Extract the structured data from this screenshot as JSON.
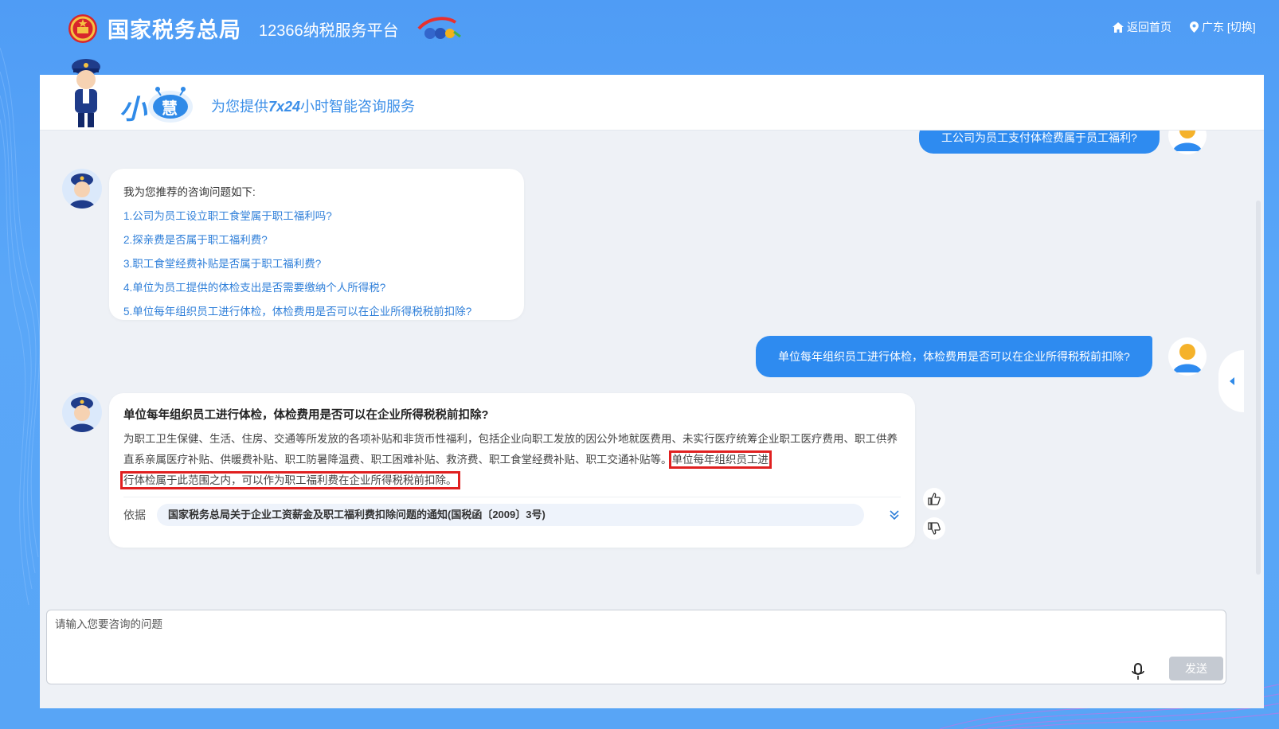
{
  "header": {
    "brand": "国家税务总局",
    "platform": "12366纳税服务平台",
    "home_link": "返回首页",
    "region": "广东 [切换]"
  },
  "assistant": {
    "name_part1": "小",
    "name_part2": "慧",
    "tagline_pre": "为您提供",
    "tagline_hl": "7x24",
    "tagline_post": "小时智能咨询服务"
  },
  "chat": {
    "user_msg_1": "工公司为员工支付体检费属于员工福利?",
    "recommend": {
      "intro": "我为您推荐的咨询问题如下:",
      "items": [
        "1.公司为员工设立职工食堂属于职工福利吗?",
        "2.探亲费是否属于职工福利费?",
        "3.职工食堂经费补贴是否属于职工福利费?",
        "4.单位为员工提供的体检支出是否需要缴纳个人所得税?",
        "5.单位每年组织员工进行体检，体检费用是否可以在企业所得税税前扣除?"
      ]
    },
    "user_msg_2": "单位每年组织员工进行体检，体检费用是否可以在企业所得税税前扣除?",
    "answer": {
      "title": "单位每年组织员工进行体检，体检费用是否可以在企业所得税税前扣除?",
      "body_plain": "为职工卫生保健、生活、住房、交通等所发放的各项补贴和非货币性福利，包括企业向职工发放的因公外地就医费用、未实行医疗统筹企业职工医疗费用、职工供养直系亲属医疗补贴、供暖费补贴、职工防暑降温费、职工困难补贴、救济费、职工食堂经费补贴、职工交通补贴等。",
      "body_highlight_1": "单位每年组织员工进",
      "body_highlight_2": "行体检属于此范围之内，可以作为职工福利费在企业所得税税前扣除。",
      "basis_label": "依据",
      "basis_doc": "国家税务总局关于企业工资薪金及职工福利费扣除问题的通知(国税函〔2009〕3号)"
    }
  },
  "input": {
    "placeholder": "请输入您要咨询的问题",
    "send_label": "发送"
  },
  "colors": {
    "primary": "#2e8bf0",
    "link": "#2f7fd9",
    "highlight_box": "#e02020",
    "send_disabled": "#c5cad2"
  }
}
